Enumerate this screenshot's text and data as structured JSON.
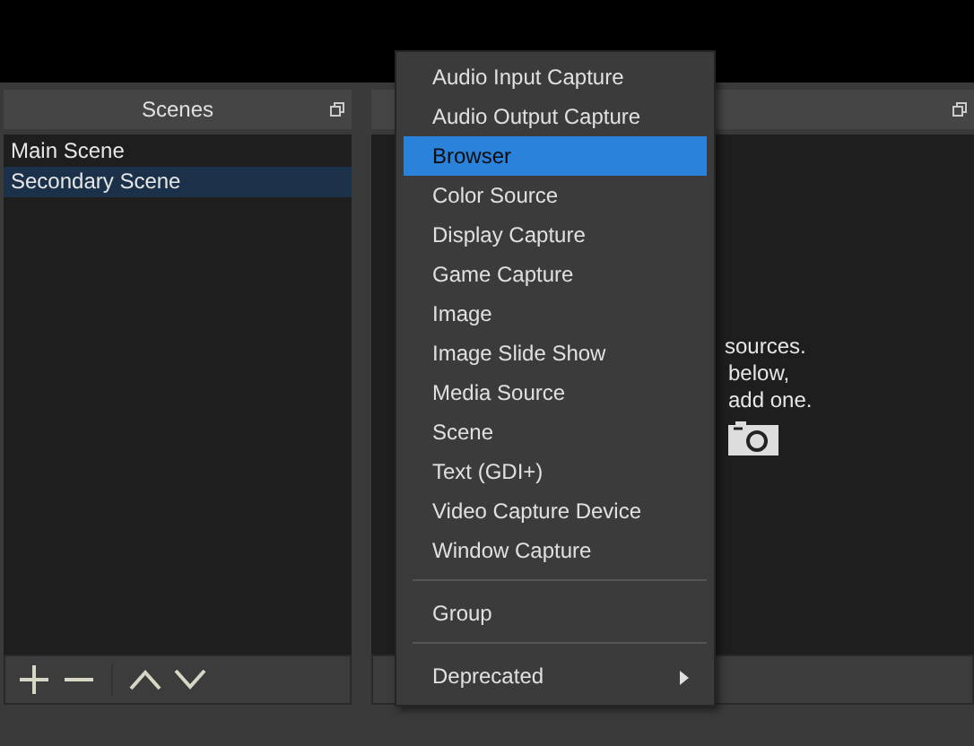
{
  "scenes": {
    "title": "Scenes",
    "items": [
      {
        "label": "Main Scene",
        "selected": false
      },
      {
        "label": "Secondary Scene",
        "selected": true
      }
    ]
  },
  "sources": {
    "hint_lines": [
      "sources.",
      "below,",
      "add one."
    ]
  },
  "add_source_menu": {
    "items": [
      {
        "kind": "item",
        "label": "Audio Input Capture",
        "selected": false
      },
      {
        "kind": "item",
        "label": "Audio Output Capture",
        "selected": false
      },
      {
        "kind": "item",
        "label": "Browser",
        "selected": true
      },
      {
        "kind": "item",
        "label": "Color Source",
        "selected": false
      },
      {
        "kind": "item",
        "label": "Display Capture",
        "selected": false
      },
      {
        "kind": "item",
        "label": "Game Capture",
        "selected": false
      },
      {
        "kind": "item",
        "label": "Image",
        "selected": false
      },
      {
        "kind": "item",
        "label": "Image Slide Show",
        "selected": false
      },
      {
        "kind": "item",
        "label": "Media Source",
        "selected": false
      },
      {
        "kind": "item",
        "label": "Scene",
        "selected": false
      },
      {
        "kind": "item",
        "label": "Text (GDI+)",
        "selected": false
      },
      {
        "kind": "item",
        "label": "Video Capture Device",
        "selected": false
      },
      {
        "kind": "item",
        "label": "Window Capture",
        "selected": false
      },
      {
        "kind": "separator"
      },
      {
        "kind": "item",
        "label": "Group",
        "selected": false
      },
      {
        "kind": "separator"
      },
      {
        "kind": "submenu",
        "label": "Deprecated",
        "selected": false
      }
    ]
  }
}
